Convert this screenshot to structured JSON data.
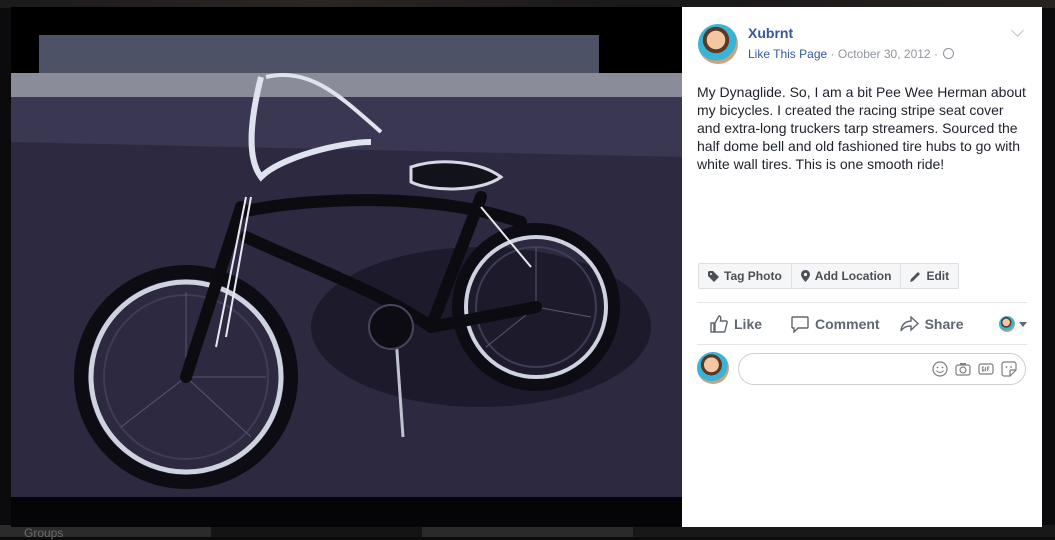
{
  "post": {
    "page_name": "Xubrnt",
    "like_link": "Like This Page",
    "separator": "·",
    "date": "October 30, 2012",
    "caption": "My Dynaglide. So, I am a bit Pee Wee Herman about my bicycles. I created the racing stripe seat cover and extra-long truckers tarp streamers. Sourced the half dome bell and old fashioned tire hubs to go with white wall tires. This is one smooth ride!"
  },
  "photo_toolbar": {
    "tag_photo": "Tag Photo",
    "add_location": "Add Location",
    "edit": "Edit"
  },
  "actions": {
    "like": "Like",
    "comment": "Comment",
    "share": "Share"
  },
  "comment_composer": {
    "icons": [
      "emoji-icon",
      "camera-icon",
      "gif-icon",
      "sticker-icon"
    ]
  },
  "background": {
    "caption_fragment": "Groups"
  },
  "colors": {
    "link_blue": "#365899",
    "meta_gray": "#90949c",
    "text": "#1d2129"
  }
}
